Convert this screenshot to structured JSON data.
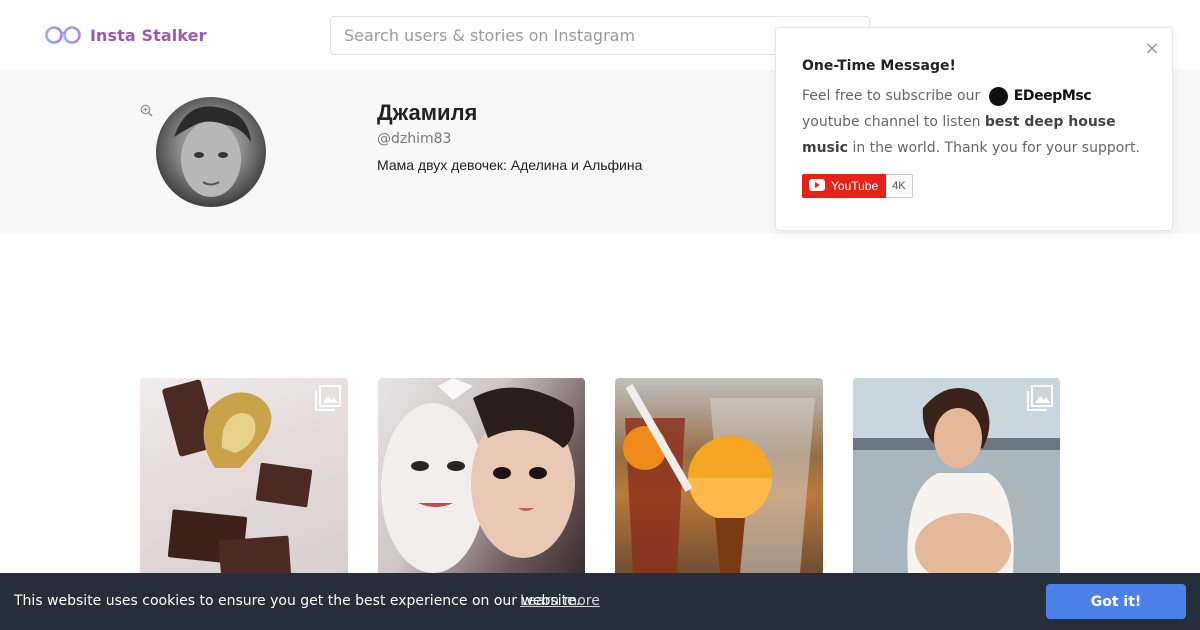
{
  "header": {
    "logo_text": "Insta Stalker",
    "search_placeholder": "Search users & stories on Instagram"
  },
  "profile": {
    "name": "Джамиля",
    "handle": "@dzhim83",
    "bio": "Мама двух девочек: Аделина и Альфина"
  },
  "popup": {
    "title": "One-Time Message!",
    "text_before_brand": "Feel free to subscribe our",
    "brand_name": "EDeepMsc",
    "text_after_brand": "youtube channel to listen",
    "highlight": "best deep house music",
    "text_end": "in the world. Thank you for your support.",
    "youtube_label": "YouTube",
    "subscriber_count": "4K",
    "close_symbol": "×"
  },
  "posts": [
    {
      "icon": "gallery-icon"
    },
    {
      "icon": "gallery-icon"
    },
    {
      "icon": "gallery-icon"
    },
    {
      "icon": "gallery-icon"
    }
  ],
  "cookie_banner": {
    "message": "This website uses cookies to ensure you get the best experience on our website.",
    "learn_more": "Learn more",
    "button": "Got it!"
  },
  "colors": {
    "brand_purple": "#9b59b6",
    "cookie_bg": "#252e39",
    "cookie_button": "#4b81e8",
    "youtube_red": "#e62117"
  }
}
